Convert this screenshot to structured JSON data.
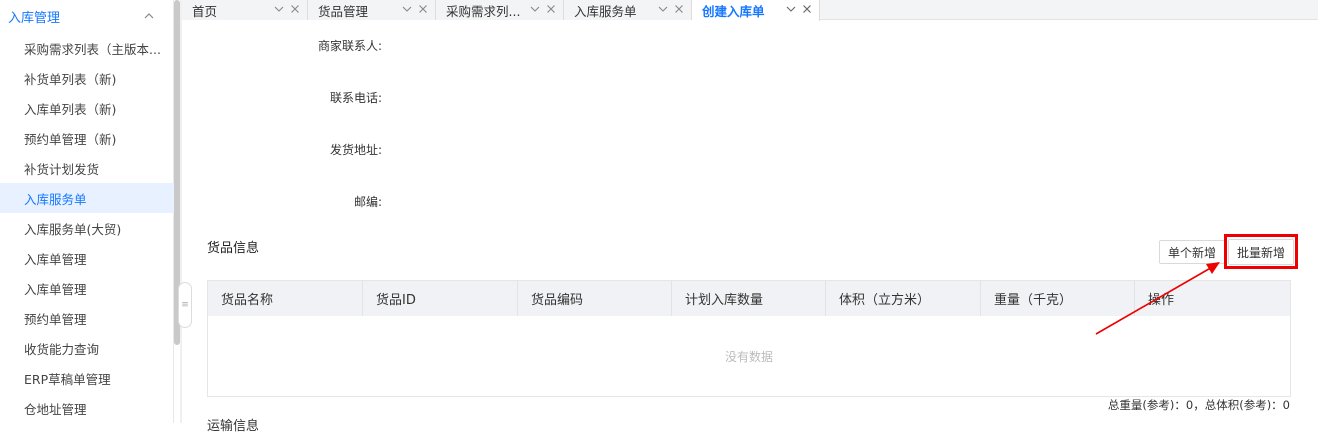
{
  "sidebar": {
    "group_label": "入库管理",
    "items": [
      {
        "label": "采购需求列表（主版本..."
      },
      {
        "label": "补货单列表（新)"
      },
      {
        "label": "入库单列表（新)"
      },
      {
        "label": "预约单管理（新)"
      },
      {
        "label": "补货计划发货"
      },
      {
        "label": "入库服务单"
      },
      {
        "label": "入库服务单(大贸)"
      },
      {
        "label": "入库单管理"
      },
      {
        "label": "入库单管理"
      },
      {
        "label": "预约单管理"
      },
      {
        "label": "收货能力查询"
      },
      {
        "label": "ERP草稿单管理"
      },
      {
        "label": "仓地址管理"
      }
    ],
    "active_index": 5
  },
  "tabs": [
    {
      "label": "首页"
    },
    {
      "label": "货品管理"
    },
    {
      "label": "采购需求列..."
    },
    {
      "label": "入库服务单"
    },
    {
      "label": "创建入库单"
    }
  ],
  "form": {
    "merchant_contact_label": "商家联系人:",
    "phone_label": "联系电话:",
    "ship_address_label": "发货地址:",
    "postcode_label": "邮编:"
  },
  "goods": {
    "section_title": "货品信息",
    "single_add_label": "单个新增",
    "batch_add_label": "批量新增",
    "columns": [
      "货品名称",
      "货品ID",
      "货品编码",
      "计划入库数量",
      "体积（立方米）",
      "重量（千克）",
      "操作"
    ],
    "empty_text": "没有数据",
    "summary_text": "总重量(参考)：0，总体积(参考)：0"
  },
  "next_section_title": "运输信息",
  "colors": {
    "accent": "#1677ff",
    "highlight": "#e00000"
  }
}
